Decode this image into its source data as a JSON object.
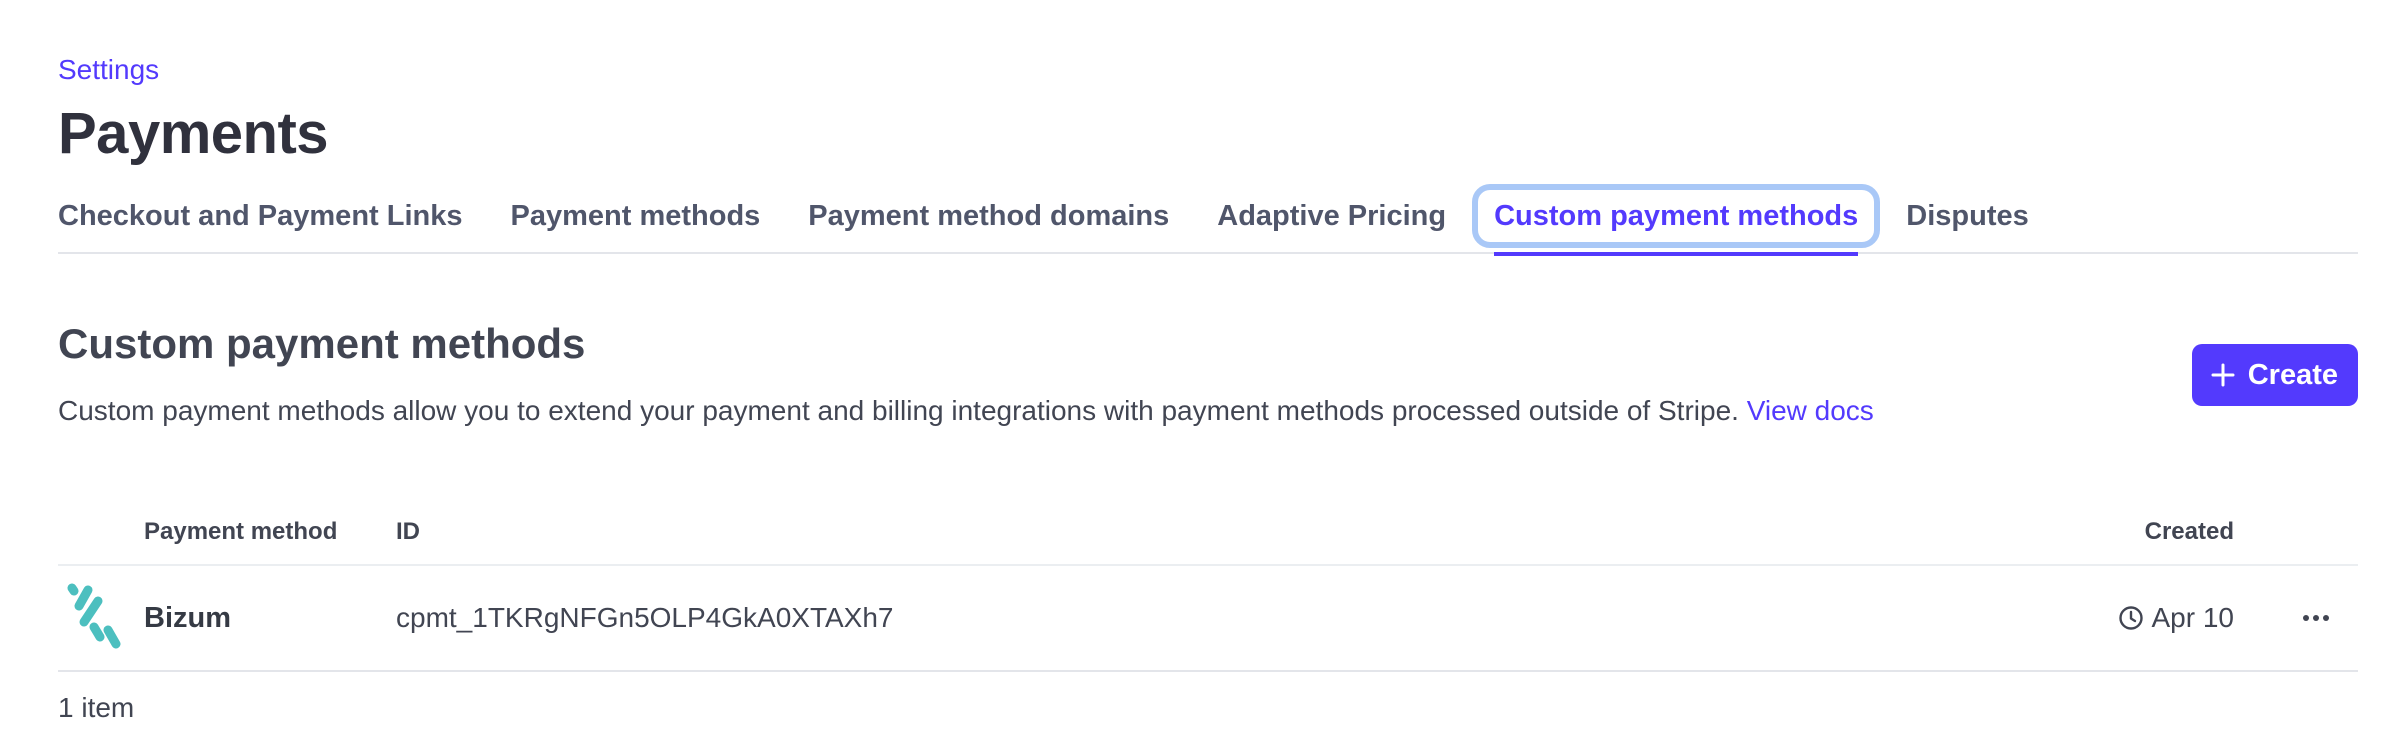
{
  "breadcrumb": {
    "label": "Settings"
  },
  "page": {
    "title": "Payments"
  },
  "tabs": [
    {
      "label": "Checkout and Payment Links",
      "active": false
    },
    {
      "label": "Payment methods",
      "active": false
    },
    {
      "label": "Payment method domains",
      "active": false
    },
    {
      "label": "Adaptive Pricing",
      "active": false
    },
    {
      "label": "Custom payment methods",
      "active": true
    },
    {
      "label": "Disputes",
      "active": false
    }
  ],
  "section": {
    "title": "Custom payment methods",
    "description": "Custom payment methods allow you to extend your payment and billing integrations with payment methods processed outside of Stripe.",
    "docs_link": "View docs",
    "create_label": "Create",
    "create_icon": "plus-icon"
  },
  "table": {
    "columns": {
      "method": "Payment method",
      "id": "ID",
      "created": "Created"
    },
    "rows": [
      {
        "logo": "bizum-logo",
        "name": "Bizum",
        "id": "cpmt_1TKRgNFGn5OLP4GkA0XTAXh7",
        "created": "Apr 10",
        "created_icon": "clock-icon",
        "actions_icon": "more-horizontal-icon"
      }
    ],
    "count_label": "1 item"
  },
  "colors": {
    "accent": "#533afd",
    "focus_ring": "#a9c8f7",
    "bizum": "#4cbfbf",
    "title_text": "#30313d",
    "body_text": "#414552"
  }
}
